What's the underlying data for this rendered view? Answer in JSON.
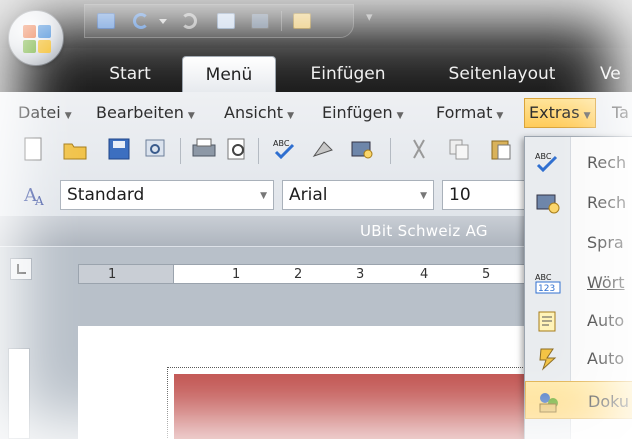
{
  "tabs": [
    "Start",
    "Menü",
    "Einfügen",
    "Seitenlayout",
    "Ve"
  ],
  "active_tab": "Menü",
  "menubar": [
    {
      "label": "Datei"
    },
    {
      "label": "Bearbeiten"
    },
    {
      "label": "Ansicht"
    },
    {
      "label": "Einfügen"
    },
    {
      "label": "Format"
    },
    {
      "label": "Extras"
    },
    {
      "label": "Ta"
    }
  ],
  "format": {
    "style": "Standard",
    "font": "Arial",
    "size": "10"
  },
  "company": "UBit Schweiz AG",
  "ruler_numbers": [
    "1",
    "1",
    "2",
    "3",
    "4",
    "5"
  ],
  "extras_menu": [
    {
      "label": "Rech",
      "icon": "spellcheck-icon"
    },
    {
      "label": "Rech",
      "icon": "research-icon"
    },
    {
      "label": "Spra",
      "icon": ""
    },
    {
      "label": "Wört",
      "icon": "word-count-icon"
    },
    {
      "label": "Auto",
      "icon": "autosummary-icon"
    },
    {
      "label": "Auto",
      "icon": "autocorrect-icon"
    },
    {
      "label": "Doku",
      "icon": "document-protect-icon"
    }
  ],
  "colors": {
    "accent": "#ffcc5a",
    "titlebar": "#262626",
    "ribbon": "#dde2e8",
    "redbox": "#c0504d"
  }
}
